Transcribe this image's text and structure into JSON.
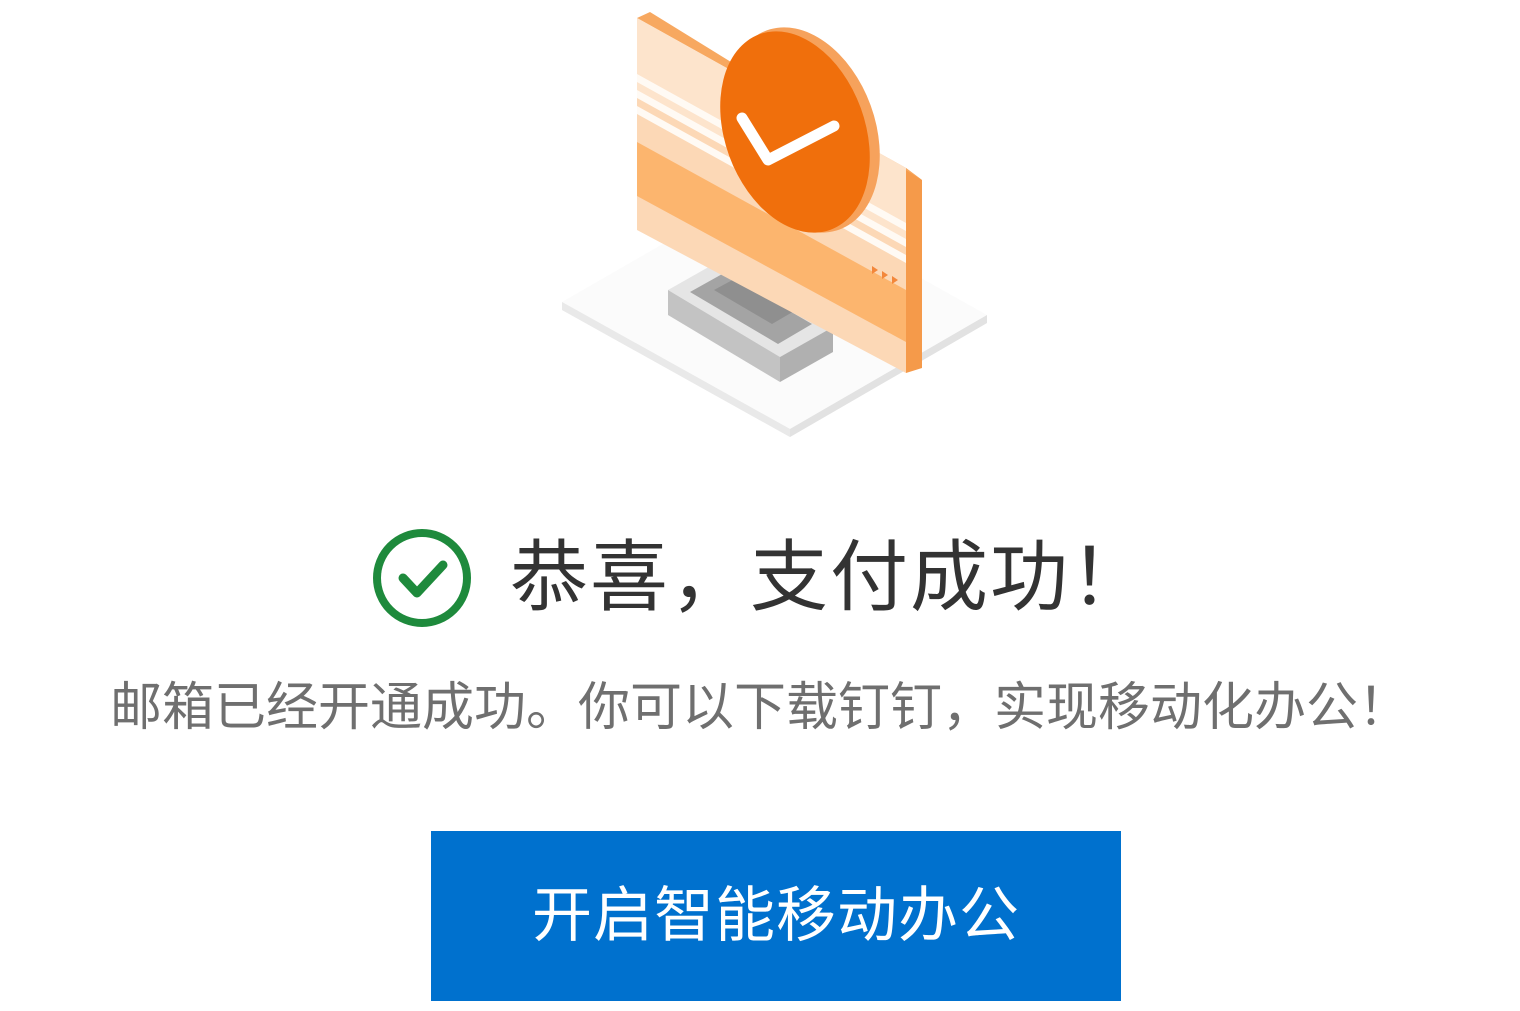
{
  "illustration": {
    "icon": "monitor-checkmark-icon",
    "accent_color": "#f07313"
  },
  "result": {
    "icon": "success-check-icon",
    "icon_color": "#1e8a3c",
    "title": "恭喜，支付成功！",
    "message": "邮箱已经开通成功。你可以下载钉钉，实现移动化办公！"
  },
  "cta": {
    "label": "开启智能移动办公",
    "color": "#0071ce"
  }
}
